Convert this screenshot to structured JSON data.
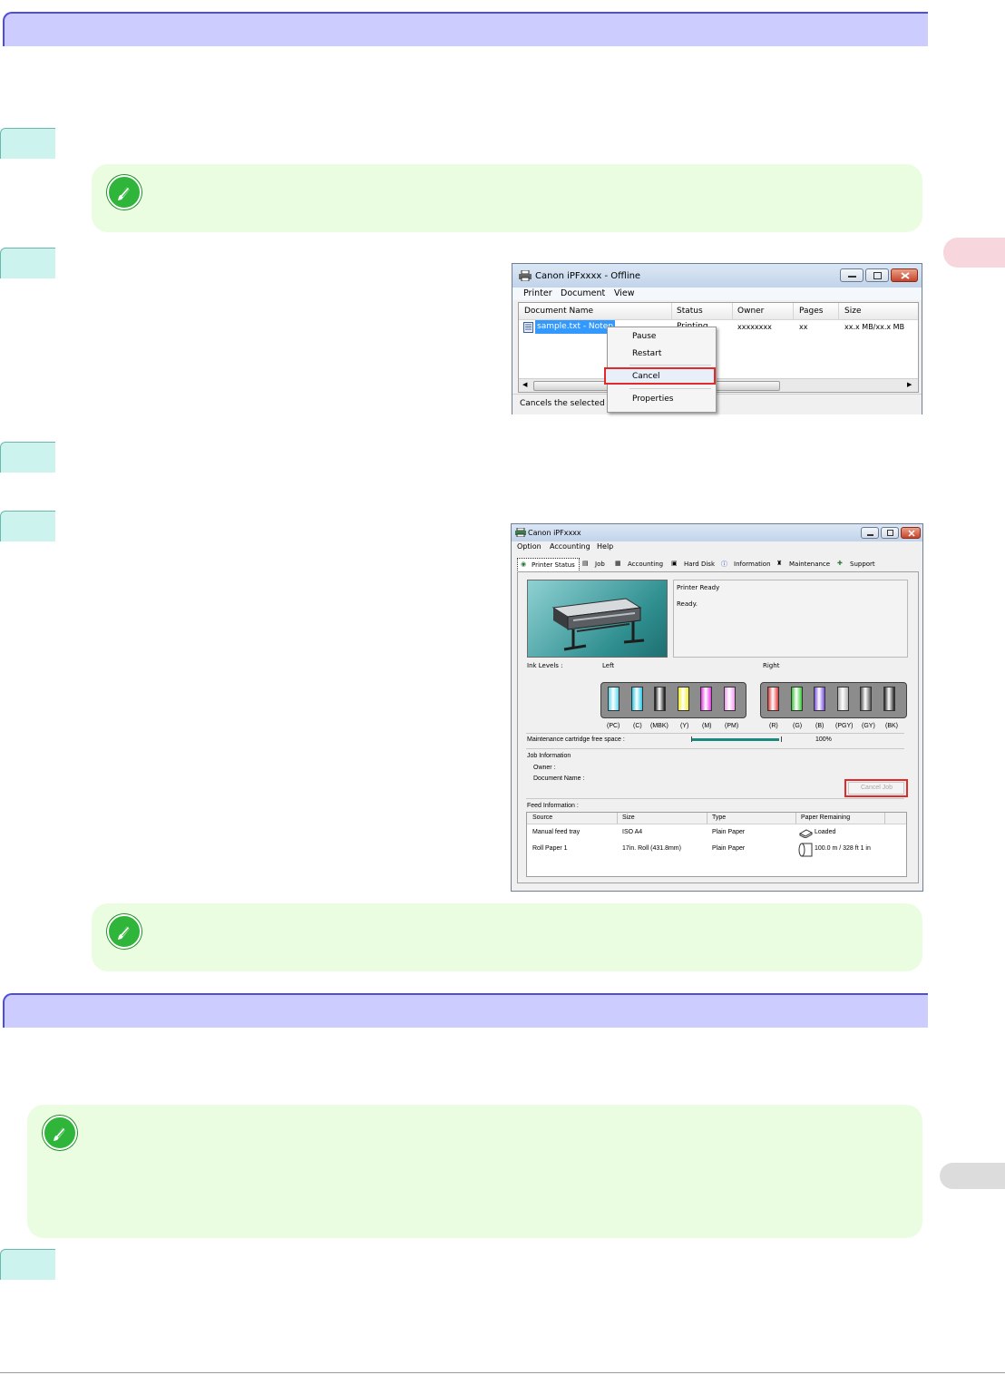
{
  "colors": {
    "section_bar": "#ccccff",
    "section_border": "#4e4ed8",
    "step_tab": "#cdf3ee",
    "note_bg": "#ebfde0",
    "note_icon": "#2fb53a",
    "side_tab_pink": "#f8d6de",
    "side_tab_gray": "#dcdcdc",
    "highlight_red": "#e12a2a",
    "selection_blue": "#3399ff"
  },
  "icons": {
    "note": "pencil-icon",
    "printer": "printer-icon",
    "document": "text-document-icon"
  },
  "printer_queue": {
    "title": "Canon iPFxxxx  - Offline",
    "menu": [
      "Printer",
      "Document",
      "View"
    ],
    "columns": [
      "Document Name",
      "Status",
      "Owner",
      "Pages",
      "Size"
    ],
    "row": {
      "name": "sample.txt - Notep",
      "status": "Printing",
      "owner": "xxxxxxxx",
      "pages": "xx",
      "size": "xx.x MB/xx.x MB"
    },
    "context_menu": [
      "Pause",
      "Restart",
      "Cancel",
      "Properties"
    ],
    "status_bar": "Cancels the selected d"
  },
  "status_monitor": {
    "title": "Canon iPFxxxx",
    "menu": [
      "Option",
      "Accounting",
      "Help"
    ],
    "tabs": [
      "Printer Status",
      "Job",
      "Accounting",
      "Hard Disk",
      "Information",
      "Maintenance",
      "Support"
    ],
    "status_lines": [
      "Printer Ready",
      "Ready."
    ],
    "ink_levels_label": "Ink Levels :",
    "left_label": "Left",
    "right_label": "Right",
    "left_inks": [
      {
        "code": "(PC)",
        "color": "#59d6ea"
      },
      {
        "code": "(C)",
        "color": "#26c8e6"
      },
      {
        "code": "(MBK)",
        "color": "#111111"
      },
      {
        "code": "(Y)",
        "color": "#f2ee2e"
      },
      {
        "code": "(M)",
        "color": "#e336e3"
      },
      {
        "code": "(PM)",
        "color": "#f29af2"
      }
    ],
    "right_inks": [
      {
        "code": "(R)",
        "color": "#e23838"
      },
      {
        "code": "(G)",
        "color": "#35c935"
      },
      {
        "code": "(B)",
        "color": "#7a4ee0"
      },
      {
        "code": "(PGY)",
        "color": "#b0b0b0"
      },
      {
        "code": "(GY)",
        "color": "#555555"
      },
      {
        "code": "(BK)",
        "color": "#222222"
      }
    ],
    "maintenance_label": "Maintenance cartridge free space :",
    "maintenance_value": "100%",
    "maintenance_level": 1.0,
    "job_info_label": "Job Information",
    "owner_label": "Owner :",
    "docname_label": "Document Name :",
    "cancel_job": "Cancel Job",
    "feed_label": "Feed Information :",
    "feed_columns": [
      "Source",
      "Size",
      "Type",
      "Paper Remaining"
    ],
    "feed_rows": [
      {
        "source": "Manual feed tray",
        "size": "ISO A4",
        "type": "Plain Paper",
        "remaining": "Loaded"
      },
      {
        "source": "Roll Paper 1",
        "size": "17in. Roll (431.8mm)",
        "type": "Plain Paper",
        "remaining": "100.0 m / 328 ft 1 in"
      }
    ]
  }
}
